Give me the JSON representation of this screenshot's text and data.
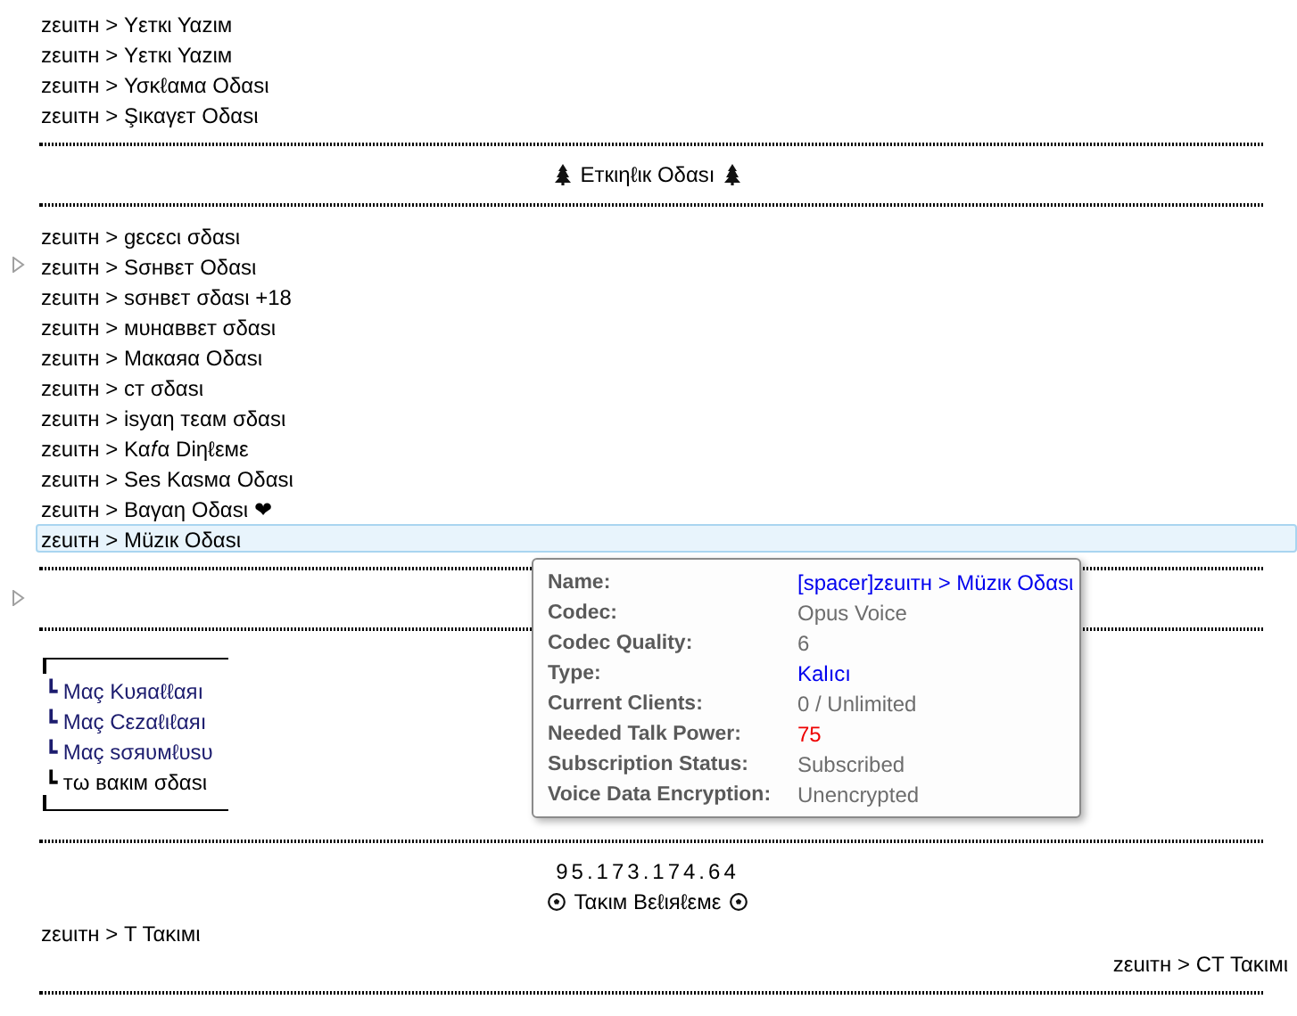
{
  "channel_tree": [
    {
      "kind": "channel",
      "label": "zεuιтн > Υεткι Υαzιм",
      "selected": false,
      "expandable": false
    },
    {
      "kind": "channel",
      "label": "zεuιтн > Υεткι Υαzιм",
      "selected": false,
      "expandable": false
    },
    {
      "kind": "channel",
      "label": "zεuιтн > Υσκℓαмα Οδαsι",
      "selected": false,
      "expandable": false
    },
    {
      "kind": "channel",
      "label": "zεuιтн > Şικαγεт Οδαsι",
      "selected": false,
      "expandable": false
    },
    {
      "kind": "spacer"
    },
    {
      "kind": "center_tree",
      "label": "Εткιηℓιк Οδαsı"
    },
    {
      "kind": "spacer"
    },
    {
      "kind": "channel",
      "label": "zεuιтн > gεcεcι σδαsι",
      "selected": false,
      "expandable": false
    },
    {
      "kind": "channel",
      "label": "zεuιтн > Sσнвεт Οδαsι",
      "selected": false,
      "expandable": true
    },
    {
      "kind": "channel",
      "label": "zεuιтн > sσнвεт σδαsι +18",
      "selected": false,
      "expandable": false
    },
    {
      "kind": "channel",
      "label": "zεuιтн > мυнαввεт σδαsι",
      "selected": false,
      "expandable": false
    },
    {
      "kind": "channel",
      "label": "zεuιтн > Μαкαяα Οδαsι",
      "selected": false,
      "expandable": false
    },
    {
      "kind": "channel",
      "label": "zεuιтн > cт σδαsι",
      "selected": false,
      "expandable": false
    },
    {
      "kind": "channel",
      "label": "zεuιтн > isyαη тεαм σδαsι",
      "selected": false,
      "expandable": false
    },
    {
      "kind": "channel",
      "label": "zεuιтн > Κα𝑓α Diηℓεмε",
      "selected": false,
      "expandable": false
    },
    {
      "kind": "channel",
      "label": "zεuιтн > Ses Καsмα Οδαsι",
      "selected": false,
      "expandable": false
    },
    {
      "kind": "channel",
      "label": "zεuιтн > Βαγαη Οδαsι ❤",
      "selected": false,
      "expandable": false
    },
    {
      "kind": "channel",
      "label": "zεuιтн > Müzιк Οδαsι",
      "selected": true,
      "expandable": false
    },
    {
      "kind": "spacer"
    },
    {
      "kind": "blank",
      "expandable": true
    },
    {
      "kind": "spacer"
    },
    {
      "kind": "box_top"
    },
    {
      "kind": "sub",
      "label": "┗ Μαç Κυяαℓℓαяı",
      "color": "#1c1c6e"
    },
    {
      "kind": "sub",
      "label": "┗ Μαç Cεzαℓιℓαяı",
      "color": "#1c1c6e"
    },
    {
      "kind": "sub",
      "label": "┗ Μαç sσяυмℓυsυ",
      "color": "#1c1c6e"
    },
    {
      "kind": "sub",
      "label": "┗ тω вαкιм σδαsι",
      "color": "#000000"
    },
    {
      "kind": "box_bottom"
    },
    {
      "kind": "spacer"
    },
    {
      "kind": "center_ip",
      "label": "95.173.174.64"
    },
    {
      "kind": "center_ball",
      "label": "Τακιм Βεℓιяℓεмε"
    },
    {
      "kind": "channel",
      "label": "zεuιтн > Τ Τακιмι",
      "selected": false,
      "expandable": false
    },
    {
      "kind": "right",
      "label": "zεuιтн >  CT Τακιмι"
    },
    {
      "kind": "spacer"
    }
  ],
  "tooltip": {
    "rows": [
      {
        "label": "Name:",
        "value": "[spacer]zεuιтн > Müzιк Οδαsι",
        "color": "#0000ee"
      },
      {
        "label": "Codec:",
        "value": "Opus Voice",
        "color": "#6d6d6d"
      },
      {
        "label": "Codec Quality:",
        "value": "6",
        "color": "#6d6d6d"
      },
      {
        "label": "Type:",
        "value": "Kalıcı",
        "color": "#0000ee"
      },
      {
        "label": "Current Clients:",
        "value": "0 / Unlimited",
        "color": "#6d6d6d"
      },
      {
        "label": "Needed Talk Power:",
        "value": "75",
        "color": "#ee0000"
      },
      {
        "label": "Subscription Status:",
        "value": "Subscribed",
        "color": "#6d6d6d"
      },
      {
        "label": "Voice Data Encryption:",
        "value": "Unencrypted",
        "color": "#6d6d6d"
      }
    ]
  }
}
